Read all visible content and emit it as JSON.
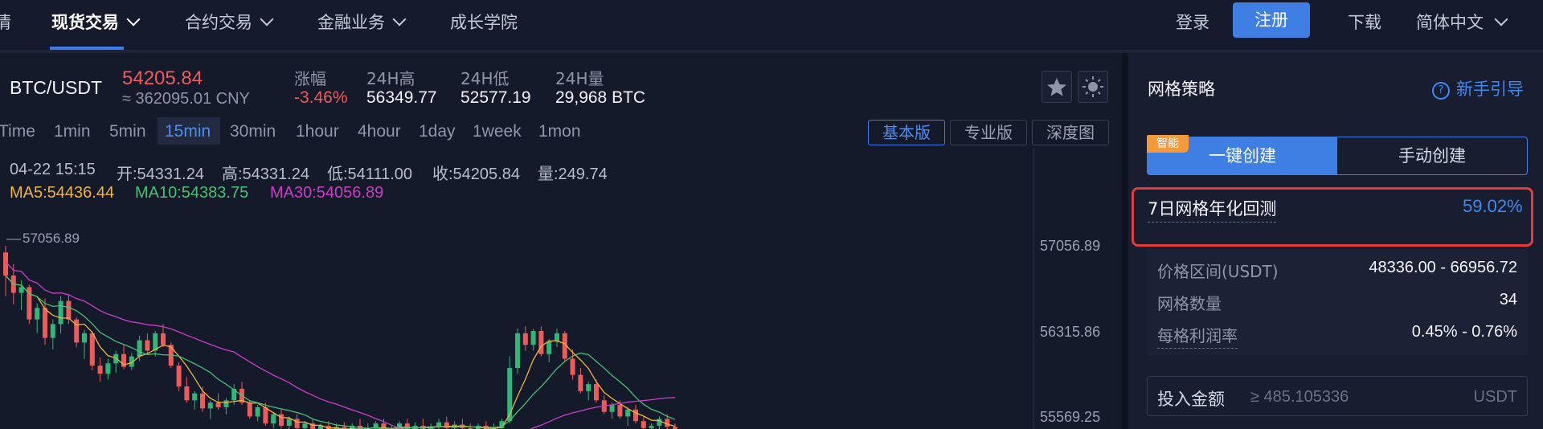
{
  "nav": {
    "items": [
      "行情",
      "现货交易",
      "合约交易",
      "金融业务",
      "成长学院"
    ],
    "login": "登录",
    "register": "注册",
    "download": "下载",
    "language": "简体中文"
  },
  "ticker": {
    "pair": "BTC/USDT",
    "price": "54205.84",
    "cny": "≈ 362095.01 CNY",
    "stats": [
      {
        "label": "涨幅",
        "value": "-3.46%"
      },
      {
        "label": "24H高",
        "value": "56349.77"
      },
      {
        "label": "24H低",
        "value": "52577.19"
      },
      {
        "label": "24H量",
        "value": "29,968 BTC"
      }
    ]
  },
  "timeframes": [
    "Time",
    "1min",
    "5min",
    "15min",
    "30min",
    "1hour",
    "4hour",
    "1day",
    "1week",
    "1mon"
  ],
  "active_timeframe": "15min",
  "versions": [
    "基本版",
    "专业版",
    "深度图"
  ],
  "active_version": "基本版",
  "candle_info": {
    "time": "04-22 15:15",
    "open": "开:54331.24",
    "high": "高:54331.24",
    "low": "低:54111.00",
    "close": "收:54205.84",
    "volume": "量:249.74"
  },
  "ma": {
    "ma5": "MA5:54436.44",
    "ma10": "MA10:54383.75",
    "ma30": "MA30:54056.89"
  },
  "chart_data": {
    "type": "candlestick",
    "y_ticks": [
      "57056.89",
      "56315.86",
      "55569.25"
    ],
    "max_label": "57056.89",
    "ylim": [
      55400,
      57300
    ],
    "candles": [
      [
        57000,
        57056.89,
        56620,
        56800
      ],
      [
        56800,
        56900,
        56550,
        56650
      ],
      [
        56650,
        56760,
        56500,
        56700
      ],
      [
        56700,
        56720,
        56380,
        56420
      ],
      [
        56420,
        56560,
        56300,
        56520
      ],
      [
        56520,
        56600,
        56200,
        56260
      ],
      [
        56260,
        56420,
        56160,
        56380
      ],
      [
        56380,
        56620,
        56300,
        56580
      ],
      [
        56580,
        56640,
        56380,
        56420
      ],
      [
        56420,
        56440,
        56180,
        56220
      ],
      [
        56220,
        56330,
        56080,
        56300
      ],
      [
        56300,
        56320,
        55980,
        56020
      ],
      [
        56020,
        56090,
        55880,
        55950
      ],
      [
        55950,
        56080,
        55900,
        56040
      ],
      [
        56040,
        56150,
        55960,
        56120
      ],
      [
        56120,
        56200,
        55990,
        56010
      ],
      [
        56010,
        56130,
        55980,
        56100
      ],
      [
        56100,
        56280,
        56060,
        56240
      ],
      [
        56240,
        56300,
        56120,
        56150
      ],
      [
        56150,
        56320,
        56100,
        56300
      ],
      [
        56300,
        56380,
        56180,
        56200
      ],
      [
        56200,
        56220,
        56000,
        56020
      ],
      [
        56020,
        56050,
        55800,
        55840
      ],
      [
        55840,
        55920,
        55700,
        55720
      ],
      [
        55720,
        55800,
        55640,
        55780
      ],
      [
        55780,
        55840,
        55620,
        55650
      ],
      [
        55650,
        55720,
        55560,
        55700
      ],
      [
        55700,
        55780,
        55640,
        55660
      ],
      [
        55660,
        55740,
        55600,
        55720
      ],
      [
        55720,
        55860,
        55680,
        55820
      ],
      [
        55820,
        55880,
        55680,
        55700
      ],
      [
        55700,
        55720,
        55560,
        55580
      ],
      [
        55580,
        55680,
        55540,
        55660
      ],
      [
        55660,
        55700,
        55500,
        55520
      ],
      [
        55520,
        55620,
        55480,
        55600
      ],
      [
        55600,
        55640,
        55480,
        55500
      ],
      [
        55500,
        55580,
        55440,
        55560
      ],
      [
        55560,
        55600,
        55460,
        55480
      ],
      [
        55480,
        55540,
        55420,
        55520
      ],
      [
        55520,
        55560,
        55440,
        55460
      ],
      [
        55460,
        55520,
        55400,
        55500
      ],
      [
        55500,
        55540,
        55420,
        55440
      ],
      [
        55440,
        55520,
        55410,
        55490
      ],
      [
        55490,
        55530,
        55420,
        55450
      ],
      [
        55450,
        55520,
        55420,
        55500
      ],
      [
        55500,
        55560,
        55440,
        55460
      ],
      [
        55460,
        55520,
        55420,
        55480
      ],
      [
        55480,
        55540,
        55440,
        55520
      ],
      [
        55520,
        55560,
        55430,
        55450
      ],
      [
        55450,
        55500,
        55410,
        55470
      ],
      [
        55470,
        55540,
        55440,
        55520
      ],
      [
        55520,
        55560,
        55450,
        55470
      ],
      [
        55470,
        55530,
        55430,
        55500
      ],
      [
        55500,
        55560,
        55450,
        55470
      ],
      [
        55470,
        55520,
        55420,
        55490
      ],
      [
        55490,
        55560,
        55460,
        55530
      ],
      [
        55530,
        55580,
        55460,
        55480
      ],
      [
        55480,
        55540,
        55440,
        55510
      ],
      [
        55510,
        55560,
        55460,
        55480
      ],
      [
        55480,
        55520,
        55420,
        55460
      ],
      [
        55460,
        55520,
        55420,
        55500
      ],
      [
        55500,
        55540,
        55440,
        55460
      ],
      [
        55460,
        55520,
        55410,
        55480
      ],
      [
        55480,
        55560,
        55460,
        55540
      ],
      [
        55540,
        56100,
        55520,
        56000
      ],
      [
        56000,
        56340,
        55950,
        56300
      ],
      [
        56300,
        56360,
        56150,
        56200
      ],
      [
        56200,
        56340,
        56150,
        56320
      ],
      [
        56320,
        56360,
        56100,
        56120
      ],
      [
        56120,
        56250,
        56050,
        56230
      ],
      [
        56230,
        56340,
        56180,
        56300
      ],
      [
        56300,
        56320,
        56060,
        56080
      ],
      [
        56080,
        56160,
        55900,
        55940
      ],
      [
        55940,
        56000,
        55780,
        55800
      ],
      [
        55800,
        55880,
        55720,
        55860
      ],
      [
        55860,
        55900,
        55700,
        55720
      ],
      [
        55720,
        55760,
        55600,
        55620
      ],
      [
        55620,
        55700,
        55560,
        55680
      ],
      [
        55680,
        55720,
        55560,
        55580
      ],
      [
        55580,
        55660,
        55500,
        55640
      ],
      [
        55640,
        55680,
        55520,
        55540
      ],
      [
        55540,
        55580,
        55460,
        55480
      ],
      [
        55480,
        55520,
        55430,
        55500
      ],
      [
        55500,
        55580,
        55460,
        55560
      ],
      [
        55560,
        55600,
        55470,
        55490
      ],
      [
        55490,
        55520,
        55420,
        55450
      ]
    ],
    "colors": {
      "up": "#2fb67a",
      "down": "#ee5b5b",
      "ma5": "#f0b53b",
      "ma10": "#46c074",
      "ma30": "#c93fc4"
    }
  },
  "grid_strategy": {
    "title": "网格策略",
    "guide": "新手引导",
    "create_auto": "一键创建",
    "create_manual": "手动创建",
    "smart_badge": "智能",
    "backtest_label": "7日网格年化回测",
    "backtest_value": "59.02%",
    "params": [
      {
        "label": "价格区间(USDT)",
        "value": "48336.00 - 66956.72"
      },
      {
        "label": "网格数量",
        "value": "34"
      },
      {
        "label": "每格利润率",
        "value": "0.45% - 0.76%"
      }
    ],
    "invest_label": "投入金额",
    "invest_placeholder": "≥ 485.105336",
    "invest_unit": "USDT"
  }
}
